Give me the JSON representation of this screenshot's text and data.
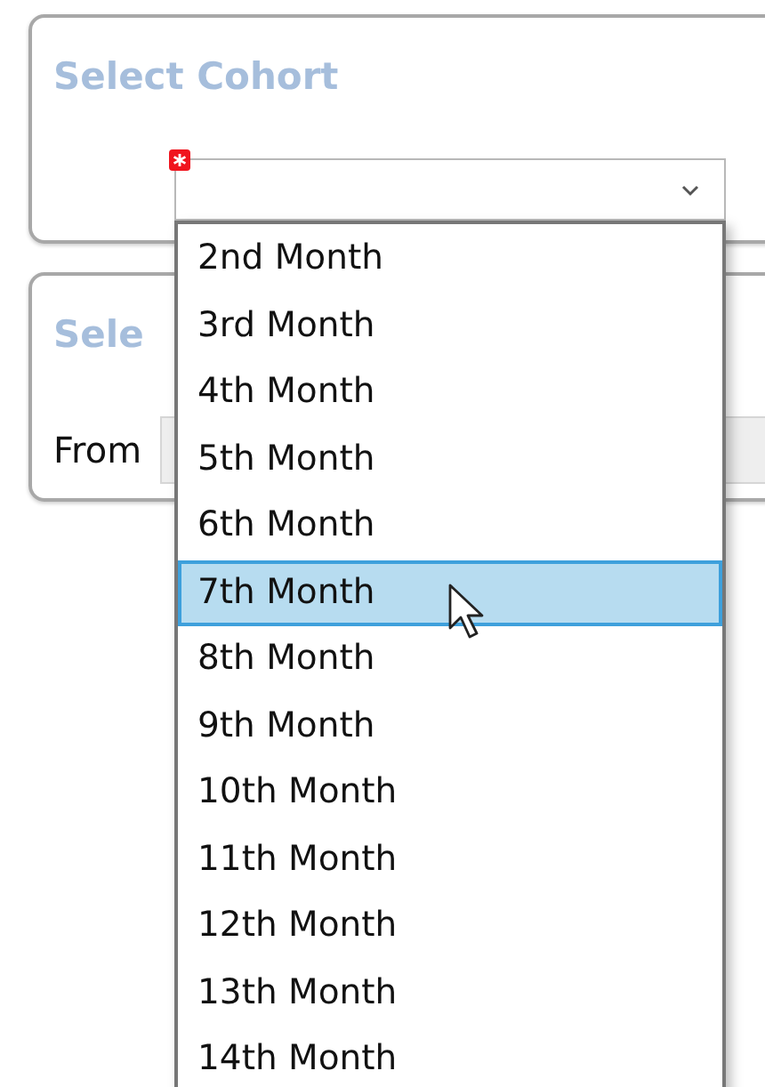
{
  "cohort_card": {
    "title": "Select Cohort",
    "select": {
      "required": true,
      "open": true,
      "options": [
        {
          "label": "2nd Month",
          "selected": false
        },
        {
          "label": "3rd Month",
          "selected": false
        },
        {
          "label": "4th Month",
          "selected": false
        },
        {
          "label": "5th Month",
          "selected": false
        },
        {
          "label": "6th Month",
          "selected": false
        },
        {
          "label": "7th Month",
          "selected": true
        },
        {
          "label": "8th Month",
          "selected": false
        },
        {
          "label": "9th Month",
          "selected": false
        },
        {
          "label": "10th Month",
          "selected": false
        },
        {
          "label": "11th Month",
          "selected": false
        },
        {
          "label": "12th Month",
          "selected": false
        },
        {
          "label": "13th Month",
          "selected": false
        },
        {
          "label": "14th Month",
          "selected": false
        }
      ]
    }
  },
  "range_card": {
    "title": "Sele",
    "from_label": "From"
  }
}
